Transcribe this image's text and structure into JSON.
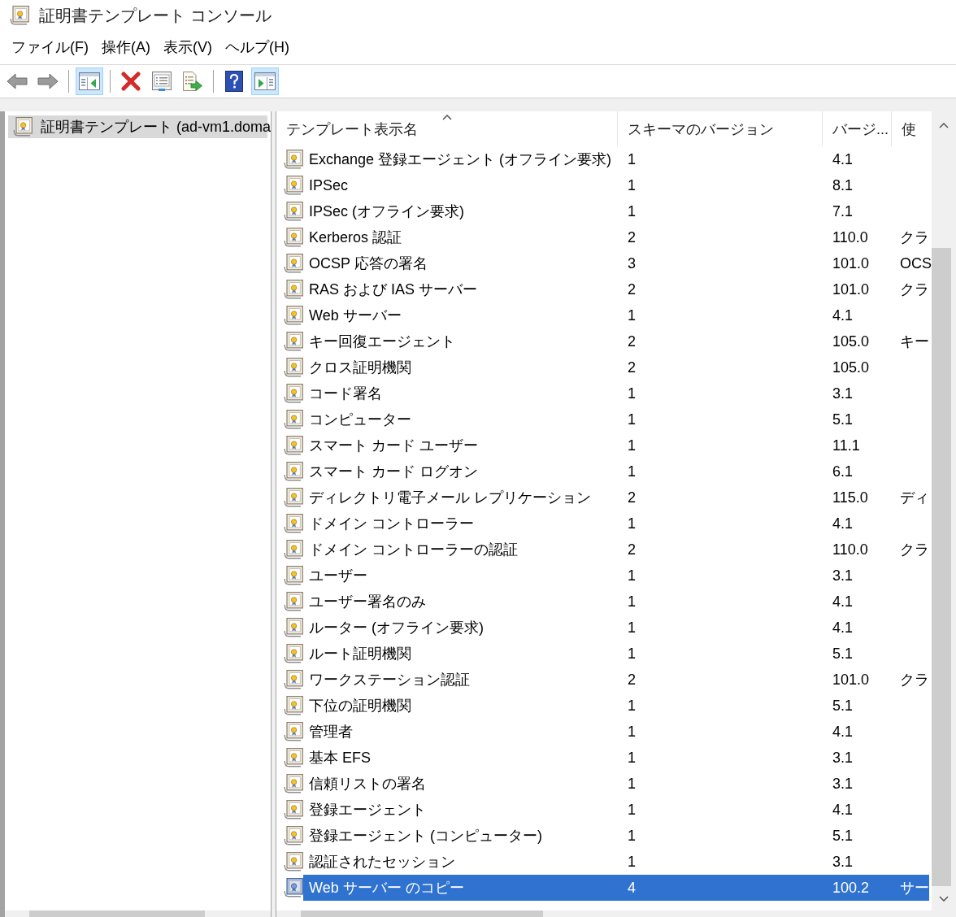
{
  "window": {
    "title": "証明書テンプレート コンソール"
  },
  "menu": [
    "ファイル(F)",
    "操作(A)",
    "表示(V)",
    "ヘルプ(H)"
  ],
  "toolbar": {
    "groups": [
      [
        {
          "kind": "back",
          "pressed": false
        },
        {
          "kind": "forward",
          "pressed": false
        }
      ],
      [
        {
          "kind": "console_tree",
          "pressed": true
        }
      ],
      [
        {
          "kind": "delete",
          "pressed": false
        },
        {
          "kind": "properties",
          "pressed": false
        },
        {
          "kind": "export_list",
          "pressed": false
        }
      ],
      [
        {
          "kind": "help",
          "pressed": false
        },
        {
          "kind": "action_pane",
          "pressed": true
        }
      ]
    ]
  },
  "tree": {
    "items": [
      {
        "label": "証明書テンプレート (ad-vm1.doma",
        "selected": true
      }
    ]
  },
  "table": {
    "columns": [
      {
        "label": "テンプレート表示名",
        "sorted": true
      },
      {
        "label": "スキーマのバージョン",
        "sorted": false
      },
      {
        "label": "バージ...",
        "sorted": false
      },
      {
        "label": "使",
        "sorted": false
      }
    ],
    "rows": [
      {
        "name": "Exchange 登録エージェント (オフライン要求)",
        "schema_version": "1",
        "version": "4.1",
        "selected": false
      },
      {
        "name": "IPSec",
        "schema_version": "1",
        "version": "8.1",
        "selected": false
      },
      {
        "name": "IPSec (オフライン要求)",
        "schema_version": "1",
        "version": "7.1",
        "selected": false
      },
      {
        "name": "Kerberos 認証",
        "schema_version": "2",
        "version": "110.0",
        "usage": "クラ",
        "selected": false
      },
      {
        "name": "OCSP 応答の署名",
        "schema_version": "3",
        "version": "101.0",
        "usage": "OCS",
        "selected": false
      },
      {
        "name": "RAS および IAS サーバー",
        "schema_version": "2",
        "version": "101.0",
        "usage": "クラ",
        "selected": false
      },
      {
        "name": "Web サーバー",
        "schema_version": "1",
        "version": "4.1",
        "selected": false
      },
      {
        "name": "キー回復エージェント",
        "schema_version": "2",
        "version": "105.0",
        "usage": "キー",
        "selected": false
      },
      {
        "name": "クロス証明機関",
        "schema_version": "2",
        "version": "105.0",
        "selected": false
      },
      {
        "name": "コード署名",
        "schema_version": "1",
        "version": "3.1",
        "selected": false
      },
      {
        "name": "コンピューター",
        "schema_version": "1",
        "version": "5.1",
        "selected": false
      },
      {
        "name": "スマート カード ユーザー",
        "schema_version": "1",
        "version": "11.1",
        "selected": false
      },
      {
        "name": "スマート カード ログオン",
        "schema_version": "1",
        "version": "6.1",
        "selected": false
      },
      {
        "name": "ディレクトリ電子メール レプリケーション",
        "schema_version": "2",
        "version": "115.0",
        "usage": "ディ",
        "selected": false
      },
      {
        "name": "ドメイン コントローラー",
        "schema_version": "1",
        "version": "4.1",
        "selected": false
      },
      {
        "name": "ドメイン コントローラーの認証",
        "schema_version": "2",
        "version": "110.0",
        "usage": "クラ",
        "selected": false
      },
      {
        "name": "ユーザー",
        "schema_version": "1",
        "version": "3.1",
        "selected": false
      },
      {
        "name": "ユーザー署名のみ",
        "schema_version": "1",
        "version": "4.1",
        "selected": false
      },
      {
        "name": "ルーター (オフライン要求)",
        "schema_version": "1",
        "version": "4.1",
        "selected": false
      },
      {
        "name": "ルート証明機関",
        "schema_version": "1",
        "version": "5.1",
        "selected": false
      },
      {
        "name": "ワークステーション認証",
        "schema_version": "2",
        "version": "101.0",
        "usage": "クラ",
        "selected": false
      },
      {
        "name": "下位の証明機関",
        "schema_version": "1",
        "version": "5.1",
        "selected": false
      },
      {
        "name": "管理者",
        "schema_version": "1",
        "version": "4.1",
        "selected": false
      },
      {
        "name": "基本 EFS",
        "schema_version": "1",
        "version": "3.1",
        "selected": false
      },
      {
        "name": "信頼リストの署名",
        "schema_version": "1",
        "version": "3.1",
        "selected": false
      },
      {
        "name": "登録エージェント",
        "schema_version": "1",
        "version": "4.1",
        "selected": false
      },
      {
        "name": "登録エージェント (コンピューター)",
        "schema_version": "1",
        "version": "5.1",
        "selected": false
      },
      {
        "name": "認証されたセッション",
        "schema_version": "1",
        "version": "3.1",
        "selected": false
      },
      {
        "name": "Web サーバー のコピー",
        "schema_version": "4",
        "version": "100.2",
        "usage": "サー",
        "selected": true
      }
    ]
  }
}
